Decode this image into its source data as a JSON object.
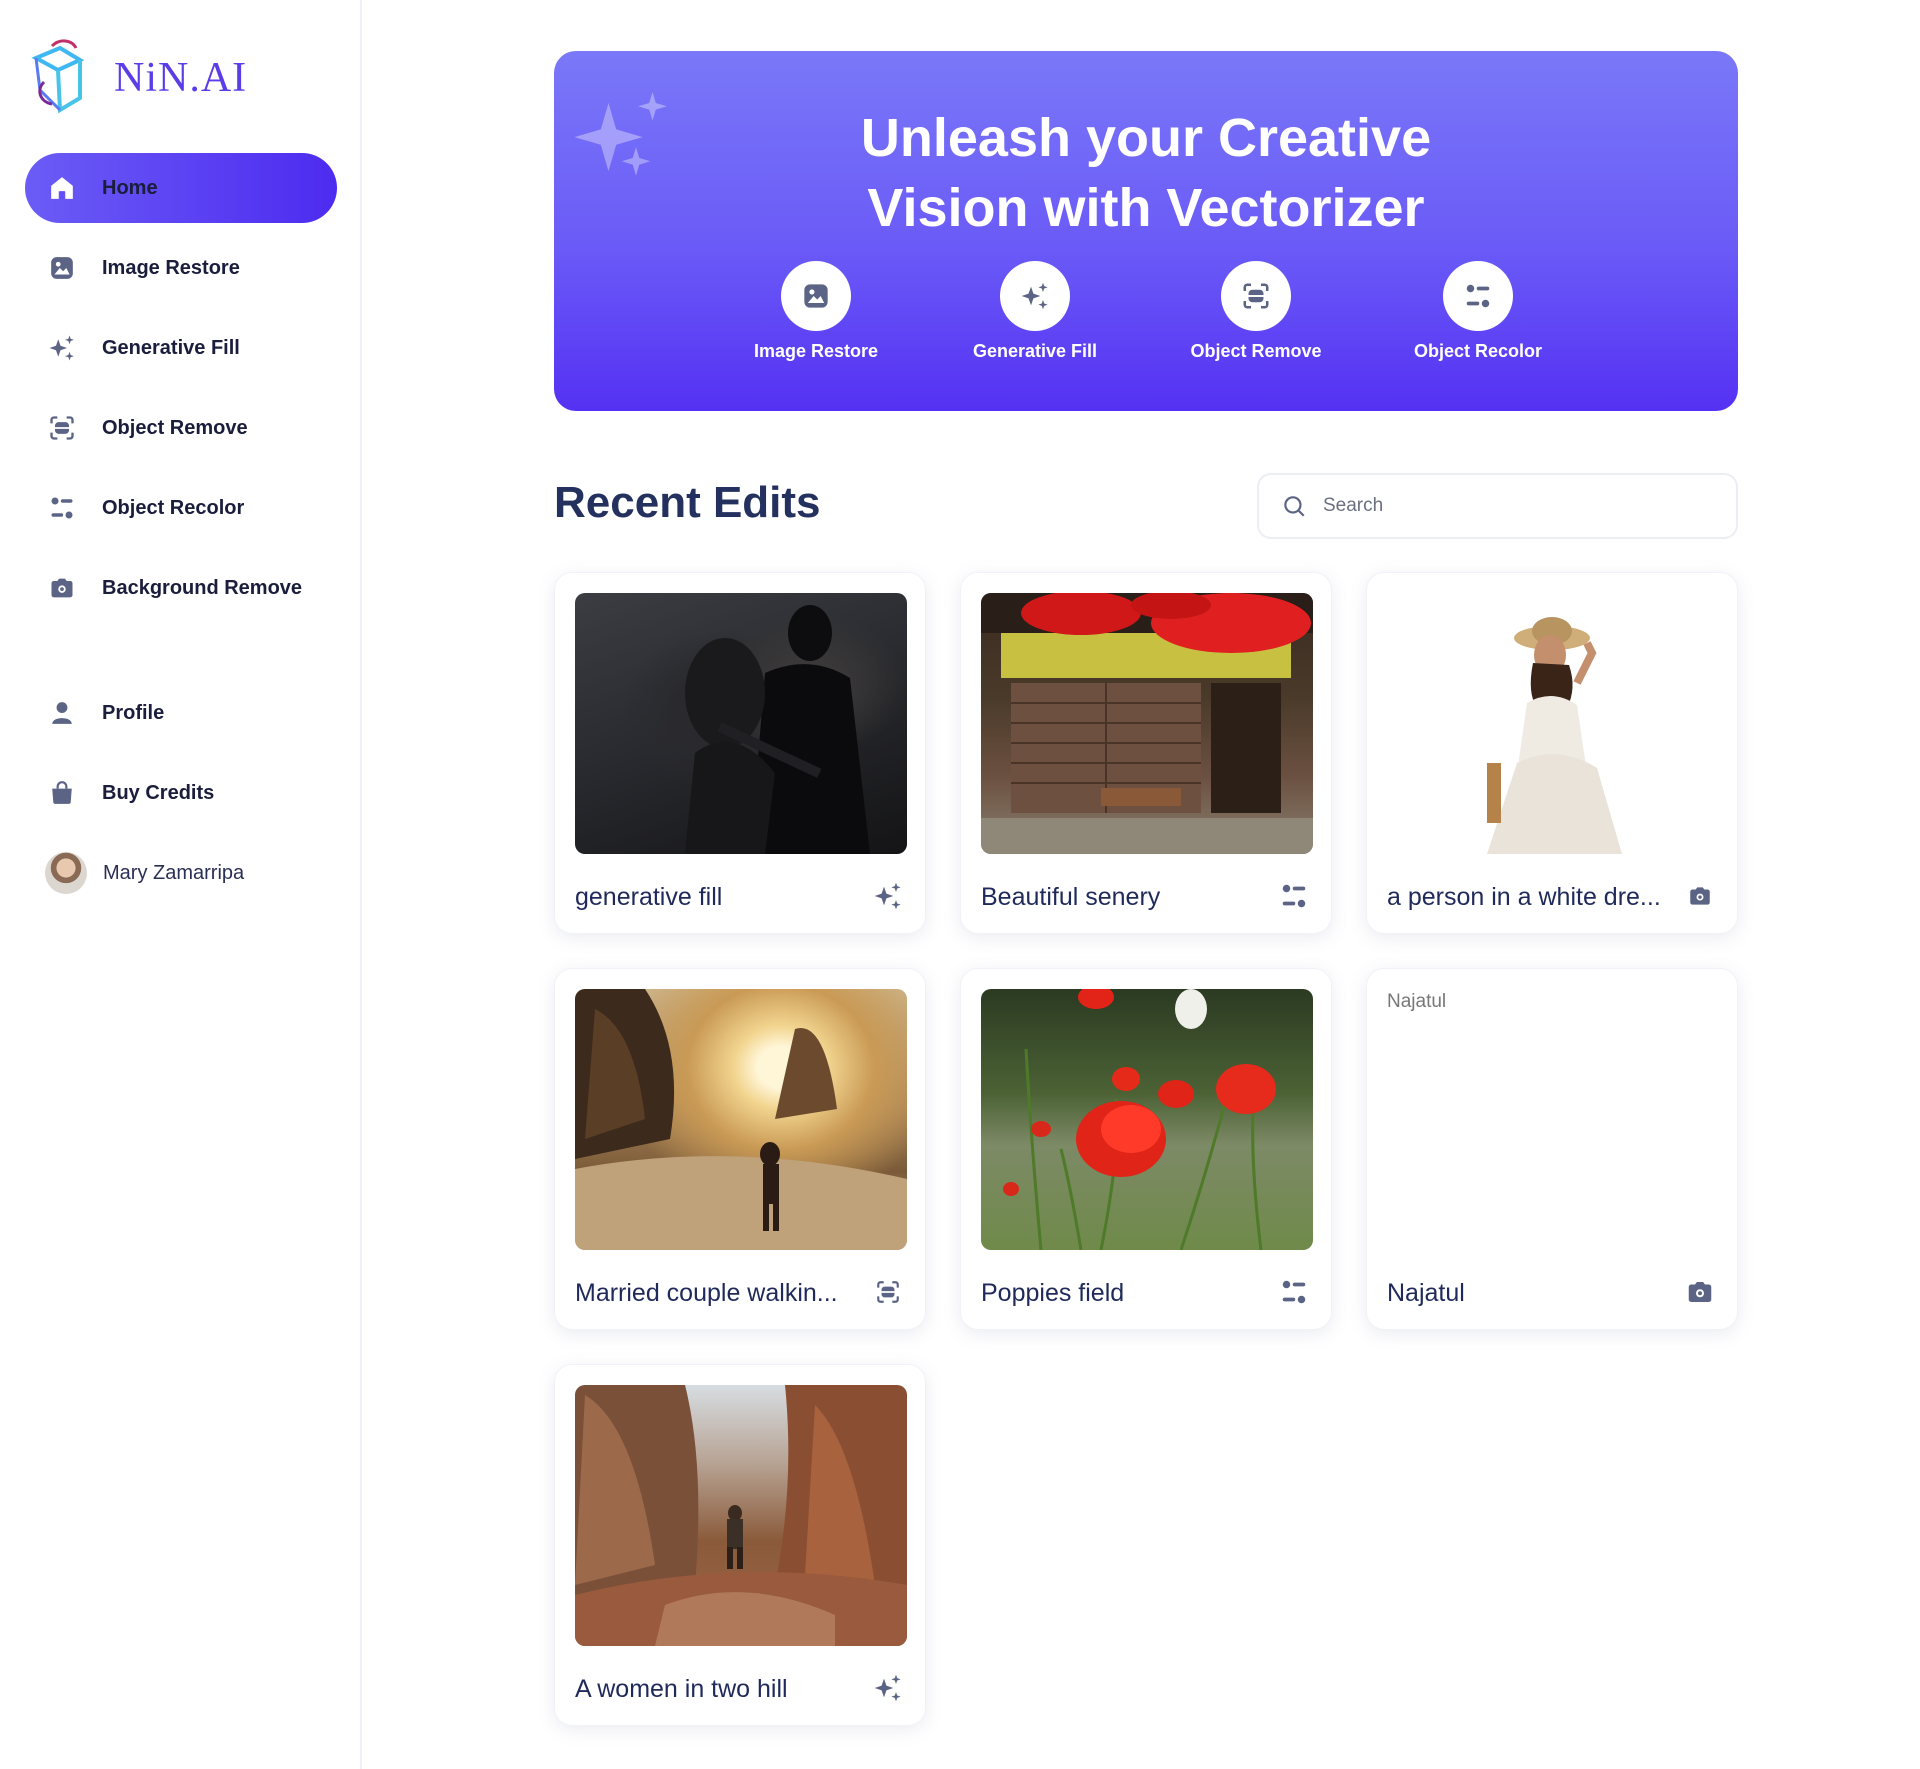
{
  "app": {
    "logo_text": "NiN.AI"
  },
  "sidebar": {
    "items": [
      {
        "label": "Home",
        "icon": "home-icon",
        "active": true
      },
      {
        "label": "Image Restore",
        "icon": "image-icon"
      },
      {
        "label": "Generative Fill",
        "icon": "sparkle-icon"
      },
      {
        "label": "Object Remove",
        "icon": "object-remove-icon"
      },
      {
        "label": "Object Recolor",
        "icon": "recolor-icon"
      },
      {
        "label": "Background Remove",
        "icon": "camera-icon"
      }
    ],
    "account_items": [
      {
        "label": "Profile",
        "icon": "user-icon"
      },
      {
        "label": "Buy Credits",
        "icon": "bag-icon"
      }
    ],
    "user": {
      "name": "Mary Zamarripa"
    }
  },
  "banner": {
    "title_line1": "Unleash your Creative",
    "title_line2": "Vision with Vectorizer",
    "tools": [
      {
        "label": "Image Restore",
        "icon": "image-icon"
      },
      {
        "label": "Generative Fill",
        "icon": "sparkle-icon"
      },
      {
        "label": "Object Remove",
        "icon": "object-remove-icon"
      },
      {
        "label": "Object Recolor",
        "icon": "recolor-icon"
      }
    ]
  },
  "recent": {
    "title": "Recent Edits",
    "search_placeholder": "Search",
    "cards": [
      {
        "title": "generative fill",
        "icon": "sparkle-icon"
      },
      {
        "title": "Beautiful senery",
        "icon": "recolor-icon"
      },
      {
        "title": "a person in a white dre...",
        "icon": "camera-icon"
      },
      {
        "title": "Married couple walkin...",
        "icon": "object-remove-icon"
      },
      {
        "title": "Poppies field",
        "icon": "recolor-icon"
      },
      {
        "title": "Najatul",
        "icon": "camera-icon",
        "broken_alt": "Najatul"
      },
      {
        "title": "A women in two hill",
        "icon": "sparkle-icon"
      }
    ]
  },
  "colors": {
    "accent": "#5b3de8",
    "text": "#1f2a5a",
    "icon": "#5c6485"
  }
}
